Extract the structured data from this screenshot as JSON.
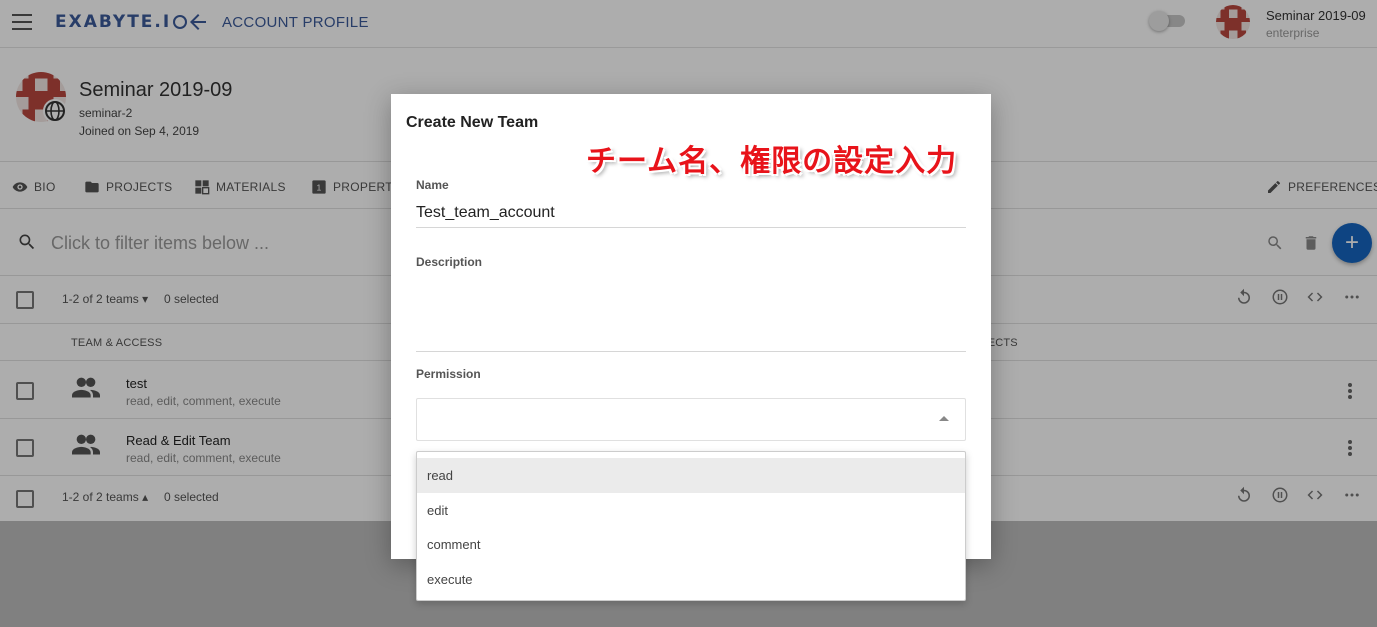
{
  "appbar": {
    "logo": "EXABYTE.I",
    "page_title": "ACCOUNT PROFILE",
    "user_name": "Seminar 2019-09",
    "user_plan": "enterprise"
  },
  "profile": {
    "name": "Seminar 2019-09",
    "slug": "seminar-2",
    "joined": "Joined on Sep 4, 2019"
  },
  "tabs": {
    "bio": "BIO",
    "projects": "PROJECTS",
    "materials": "MATERIALS",
    "properties": "PROPERTI",
    "preferences": "PREFERENCES"
  },
  "filter": {
    "placeholder": "Click to filter items below ..."
  },
  "table": {
    "count_top": "1-2 of 2 teams",
    "selected_top": "0 selected",
    "count_bottom": "1-2 of 2 teams",
    "selected_bottom": "0 selected",
    "col_team": "TEAM & ACCESS",
    "col_projects": "JECTS",
    "rows": [
      {
        "name": "test",
        "perms": "read, edit, comment, execute"
      },
      {
        "name": "Read & Edit Team",
        "perms": "read, edit, comment, execute"
      }
    ]
  },
  "dialog": {
    "title": "Create New Team",
    "name_label": "Name",
    "name_value": "Test_team_account",
    "description_label": "Description",
    "permission_label": "Permission",
    "options": [
      "read",
      "edit",
      "comment",
      "execute"
    ]
  },
  "annotation": "チーム名、権限の設定入力",
  "colors": {
    "brand": "#3b5a9a",
    "fab": "#1565c0",
    "annotation": "#e8131a"
  }
}
